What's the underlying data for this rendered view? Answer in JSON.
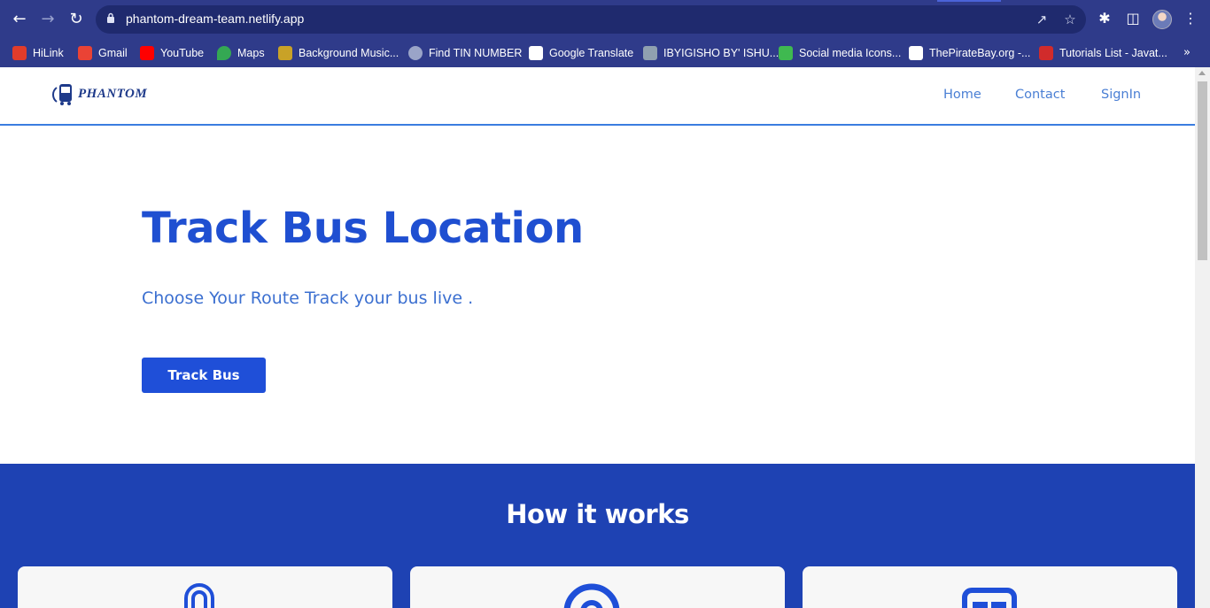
{
  "browser": {
    "url": "phantom-dream-team.netlify.app",
    "bookmarks": [
      {
        "label": "HiLink",
        "color": "#e23c2a"
      },
      {
        "label": "Gmail",
        "color": "#ea4335"
      },
      {
        "label": "YouTube",
        "color": "#ff0000"
      },
      {
        "label": "Maps",
        "color": "#34a853"
      },
      {
        "label": "Background Music...",
        "color": "#c9a227"
      },
      {
        "label": "Find TIN NUMBER",
        "color": "#9aa4c8"
      },
      {
        "label": "Google Translate",
        "color": "#ffffff"
      },
      {
        "label": "IBYIGISHO BY' ISHU...",
        "color": "#8fa0b0"
      },
      {
        "label": "Social media Icons...",
        "color": "#3fb950"
      },
      {
        "label": "ThePirateBay.org -...",
        "color": "#ffffff"
      },
      {
        "label": "Tutorials List - Javat...",
        "color": "#d12b2b"
      }
    ],
    "more": "»"
  },
  "site": {
    "brand": "PHANTOM",
    "nav": [
      "Home",
      "Contact",
      "SignIn"
    ],
    "hero": {
      "title": "Track Bus Location",
      "subtitle": "Choose Your Route Track your bus live .",
      "button": "Track Bus"
    },
    "how": {
      "title": "How it works"
    }
  },
  "colors": {
    "primary": "#1f4fd8",
    "section_bg": "#1e42b3",
    "chrome": "#2f3b8a"
  }
}
